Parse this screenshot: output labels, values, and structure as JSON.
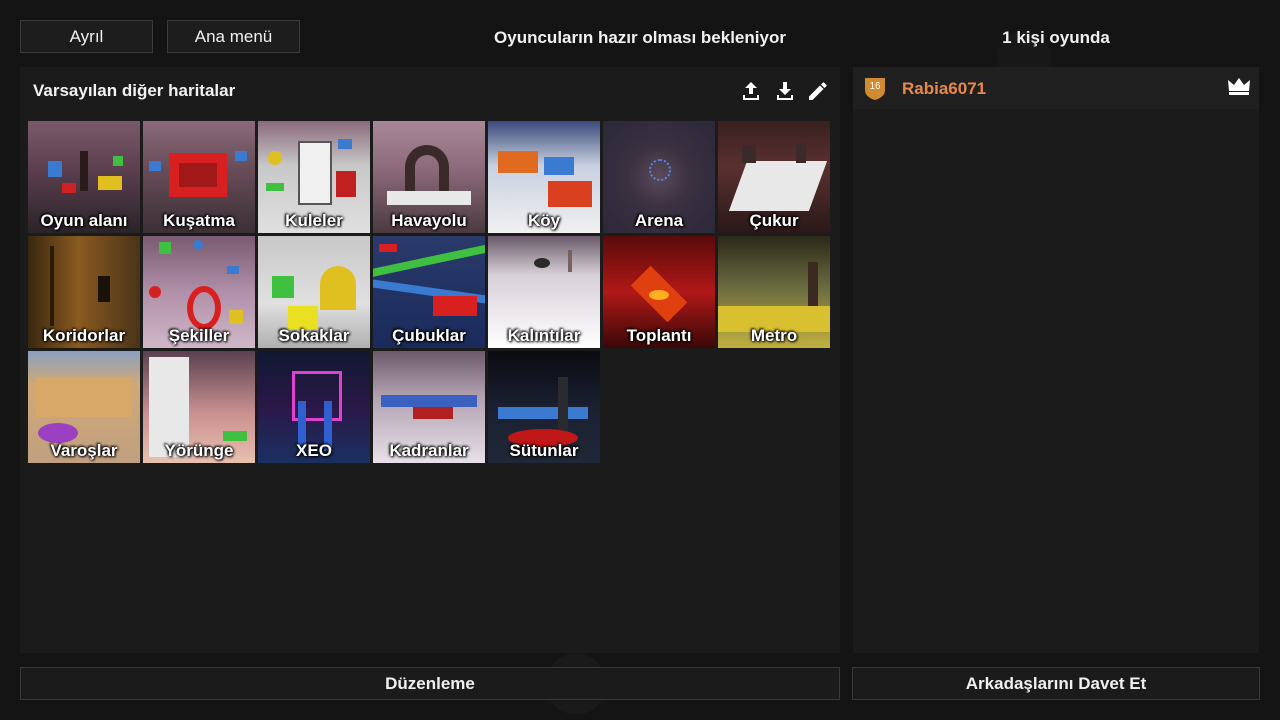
{
  "top_bar": {
    "leave_label": "Ayrıl",
    "main_menu_label": "Ana menü",
    "status_text": "Oyuncuların hazır olması bekleniyor",
    "player_count_text": "1 kişi oyunda"
  },
  "maps_panel": {
    "title": "Varsayılan diğer haritalar",
    "icons": [
      "upload-icon",
      "download-icon",
      "edit-icon"
    ],
    "maps": [
      {
        "name": "Oyun alanı"
      },
      {
        "name": "Kuşatma"
      },
      {
        "name": "Kuleler"
      },
      {
        "name": "Havayolu"
      },
      {
        "name": "Köy"
      },
      {
        "name": "Arena"
      },
      {
        "name": "Çukur"
      },
      {
        "name": "Koridorlar"
      },
      {
        "name": "Şekiller"
      },
      {
        "name": "Sokaklar"
      },
      {
        "name": "Çubuklar"
      },
      {
        "name": "Kalıntılar"
      },
      {
        "name": "Toplantı"
      },
      {
        "name": "Metro"
      },
      {
        "name": "Varoşlar"
      },
      {
        "name": "Yörünge"
      },
      {
        "name": "XEO"
      },
      {
        "name": "Kadranlar"
      },
      {
        "name": "Sütunlar"
      }
    ]
  },
  "players_panel": {
    "players": [
      {
        "name": "Rabia6071",
        "level": "16",
        "name_color": "#e8894a",
        "is_host": true
      }
    ]
  },
  "bottom_bar": {
    "edit_label": "Düzenleme",
    "invite_label": "Arkadaşlarını Davet Et"
  }
}
